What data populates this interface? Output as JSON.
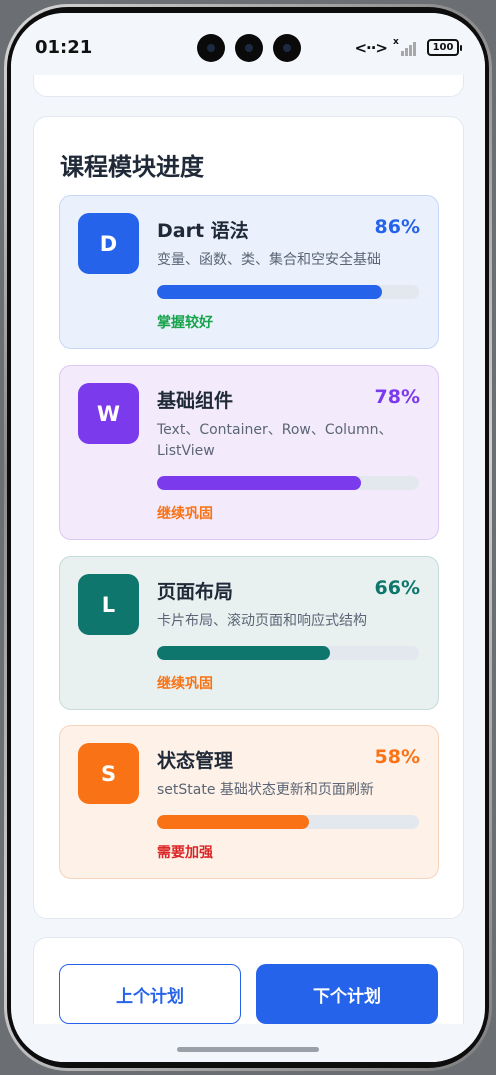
{
  "status_bar": {
    "time": "01:21",
    "link_symbol": "<··>",
    "signal_mark": "x",
    "battery": "100"
  },
  "main": {
    "title": "课程模块进度",
    "modules": [
      {
        "initial": "D",
        "name": "Dart 语法",
        "percent": "86%",
        "progress": 0.86,
        "description": "变量、函数、类、集合和空安全基础",
        "status": "掌握较好",
        "accent": "#2563eb",
        "bg": "#eaf1fc",
        "border": "#c6d6f6",
        "status_color": "#16a34a"
      },
      {
        "initial": "W",
        "name": "基础组件",
        "percent": "78%",
        "progress": 0.78,
        "description": "Text、Container、Row、Column、ListView",
        "status": "继续巩固",
        "accent": "#7c3aed",
        "bg": "#f3ebfb",
        "border": "#dcc8f3",
        "status_color": "#f97316"
      },
      {
        "initial": "L",
        "name": "页面布局",
        "percent": "66%",
        "progress": 0.66,
        "description": "卡片布局、滚动页面和响应式结构",
        "status": "继续巩固",
        "accent": "#0f766e",
        "bg": "#e8f1f0",
        "border": "#c5dcd9",
        "status_color": "#f97316"
      },
      {
        "initial": "S",
        "name": "状态管理",
        "percent": "58%",
        "progress": 0.58,
        "description": "setState 基础状态更新和页面刷新",
        "status": "需要加强",
        "accent": "#f97316",
        "bg": "#fdf1e8",
        "border": "#f6d4bc",
        "status_color": "#dc2626"
      }
    ]
  },
  "actions": {
    "prev_label": "上个计划",
    "next_label": "下个计划"
  },
  "colors": {
    "primary": "#2563eb",
    "screen_bg": "#f3f6fb"
  }
}
